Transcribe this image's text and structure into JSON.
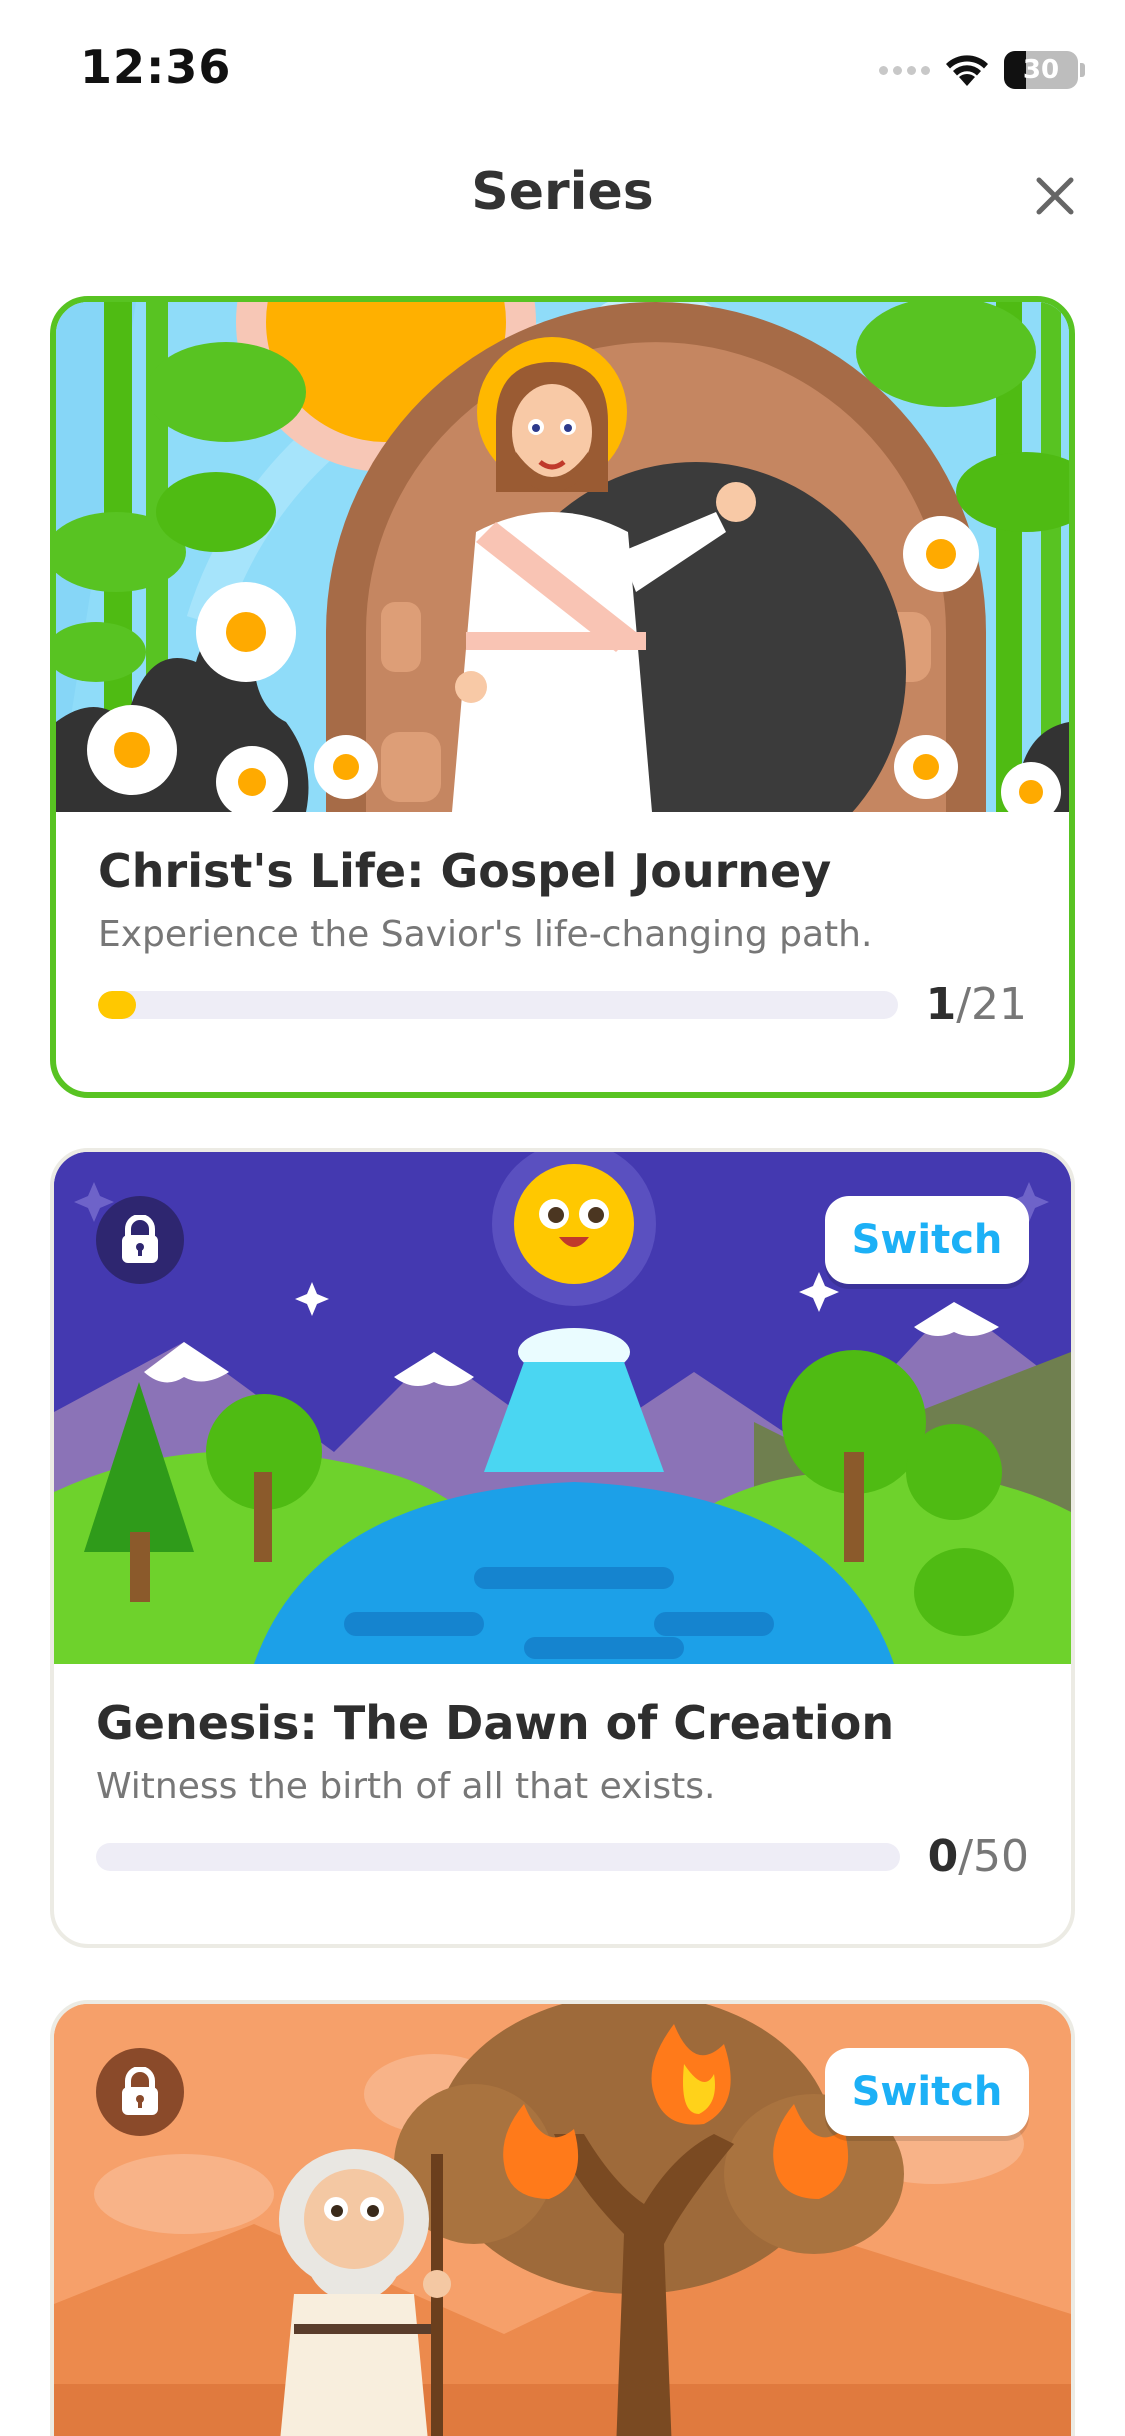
{
  "status_bar": {
    "time": "12:36",
    "battery_level": "30",
    "icons": [
      "signal-dots-icon",
      "wifi-icon",
      "battery-icon"
    ]
  },
  "header": {
    "title": "Series",
    "close_icon": "close-icon"
  },
  "series": [
    {
      "title": "Christ's Life: Gospel Journey",
      "subtitle": "Experience the Savior's life-changing path.",
      "progress_done": "1",
      "progress_total": "/21",
      "progress_fraction": 0.048,
      "state": "active"
    },
    {
      "title": "Genesis: The Dawn of Creation",
      "subtitle": "Witness the birth of all that exists.",
      "progress_done": "0",
      "progress_total": "/50",
      "progress_fraction": 0,
      "state": "locked",
      "switch_label": "Switch"
    },
    {
      "state": "locked",
      "switch_label": "Switch"
    }
  ],
  "colors": {
    "active_border": "#58c322",
    "progress_fill": "#ffc800",
    "progress_track": "#eeedf6",
    "switch_text": "#1cb0f6"
  }
}
